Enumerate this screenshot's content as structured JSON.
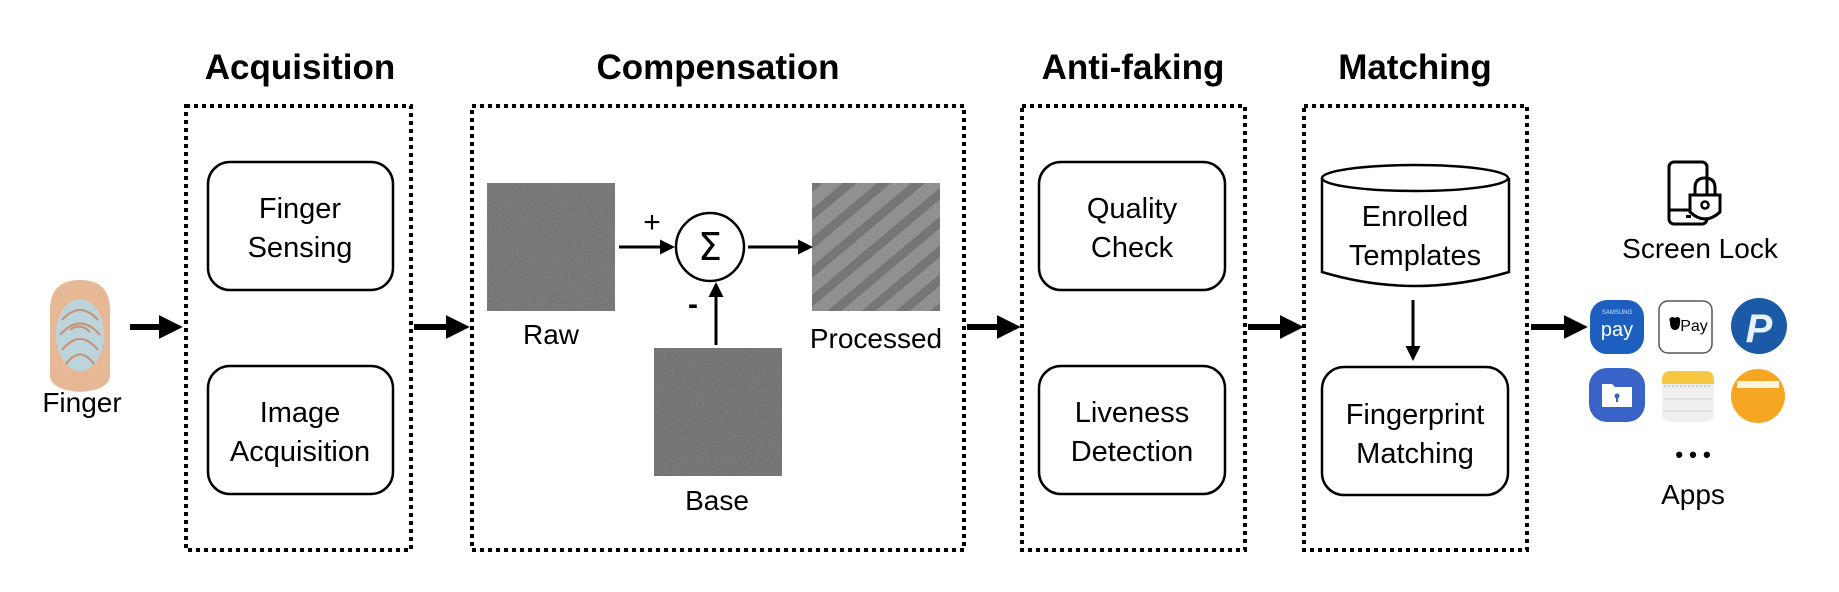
{
  "input": {
    "label": "Finger",
    "icon": "finger-icon"
  },
  "stages": [
    {
      "title": "Acquisition",
      "blocks": [
        {
          "line1": "Finger",
          "line2": "Sensing"
        },
        {
          "line1": "Image",
          "line2": "Acquisition"
        }
      ]
    },
    {
      "title": "Compensation",
      "raw_label": "Raw",
      "base_label": "Base",
      "processed_label": "Processed",
      "sum_symbol": "Σ",
      "plus_sign": "+",
      "minus_sign": "-"
    },
    {
      "title": "Anti-faking",
      "blocks": [
        {
          "line1": "Quality",
          "line2": "Check"
        },
        {
          "line1": "Liveness",
          "line2": "Detection"
        }
      ]
    },
    {
      "title": "Matching",
      "database": {
        "line1": "Enrolled",
        "line2": "Templates"
      },
      "block": {
        "line1": "Fingerprint",
        "line2": "Matching"
      }
    }
  ],
  "outputs": {
    "screen_lock_label": "Screen Lock",
    "screen_lock_icon": "phone-lock-icon",
    "apps_label": "Apps",
    "ellipsis": "• • •",
    "app_icons": [
      {
        "name": "samsung-pay-icon",
        "top": "SAMSUNG",
        "text": "pay",
        "color": "#1d5fbf"
      },
      {
        "name": "apple-pay-icon",
        "text": "Pay",
        "color": "#ffffff"
      },
      {
        "name": "paypal-icon",
        "text": "P",
        "color": "#1a5aa6"
      },
      {
        "name": "secure-folder-icon",
        "color": "#3a63c8"
      },
      {
        "name": "notes-icon",
        "color": "#f7c742"
      },
      {
        "name": "wallet-icon",
        "color": "#f5a623"
      }
    ]
  }
}
